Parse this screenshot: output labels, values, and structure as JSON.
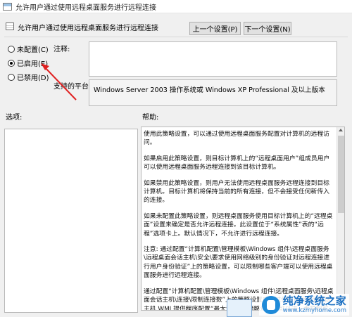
{
  "window": {
    "title": "允许用户通过使用远程桌面服务进行远程连接"
  },
  "header": {
    "policy_name": "允许用户通过使用远程桌面服务进行远程连接",
    "prev_button": "上一个设置(P)",
    "next_button": "下一个设置(N)"
  },
  "state": {
    "options": [
      {
        "label": "未配置(C)",
        "checked": false
      },
      {
        "label": "已启用(E)",
        "checked": true
      },
      {
        "label": "已禁用(D)",
        "checked": false
      }
    ]
  },
  "comment": {
    "label": "注释:",
    "value": ""
  },
  "platform": {
    "label": "支持的平台:",
    "value": "Windows Server 2003 操作系统或 Windows XP Professional 及以上版本"
  },
  "sections": {
    "options_label": "选项:",
    "help_label": "帮助:"
  },
  "help": {
    "paragraphs": [
      "使用此策略设置，可以通过使用远程桌面服务配置对计算机的远程访问。",
      "如果启用此策略设置，则目标计算机上的“远程桌面用户”组成员用户可以使用远程桌面服务远程连接到该目标计算机。",
      "如果禁用此策略设置，则用户无法使用远程桌面服务远程连接到目标计算机。目标计算机将保持当前的所有连接，但不会接受任何新传入的连接。",
      "如果未配置此策略设置，则远程桌面服务使用目标计算机上的“远程桌面”设置来确定是否允许远程连接。此设置位于“系统属性”表的“远程”选项卡上。默认情况下，不允许进行远程连接。",
      "注意: 通过配置“计算机配置\\管理模板\\Windows 组件\\远程桌面服务\\远程桌面会话主机\\安全\\要求使用网络级别的身份验证对远程连接进行用户身份验证”上的策略设置，可以限制哪些客户端可以使用远程桌面服务进行远程连接。",
      "通过配置“计算机配置\\管理模板\\Windows 组件\\远程桌面服务\\远程桌面会话主机\\连接\\限制连接数”上的策略设置或通过使用远程桌面会话主机 WMI 提供程序配置“最大连接数”策略设置，可以进一步限制可同时连接的用户数。"
    ]
  },
  "watermark": {
    "title": "纯净系统之家",
    "url": "www.kzmyhome.com"
  },
  "colors": {
    "annotation_arrow": "#e02020",
    "watermark_blue": "#1a6fc2"
  }
}
